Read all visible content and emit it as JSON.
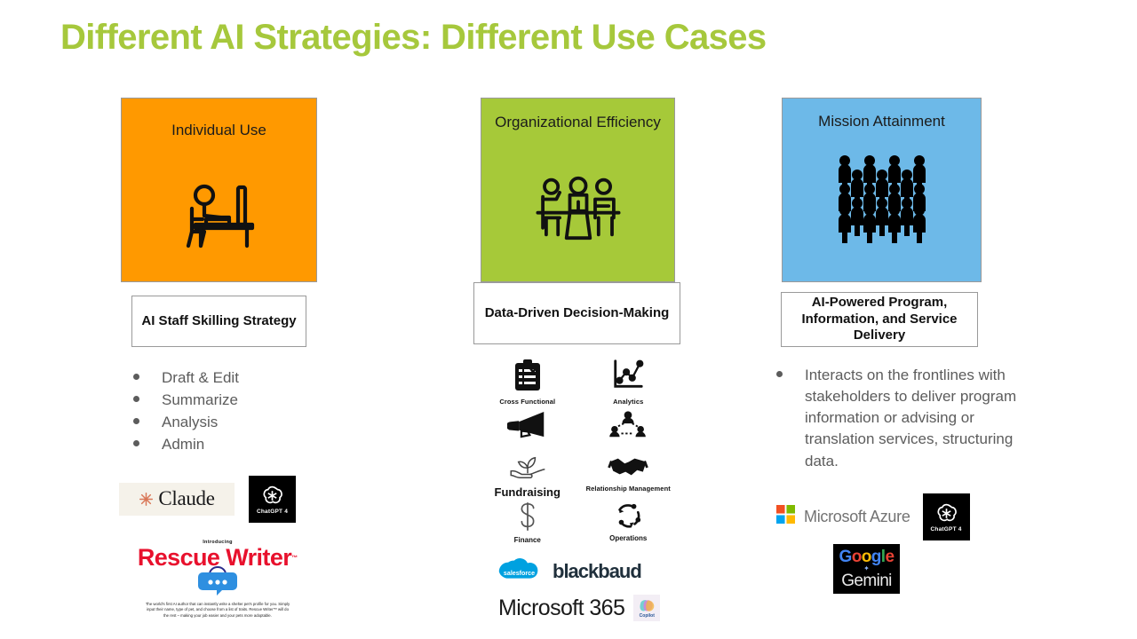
{
  "slide": {
    "title": "Different AI Strategies: Different Use Cases",
    "title_color": "#A6C83C",
    "background": "#FFFFFF"
  },
  "columns": [
    {
      "id": "individual-use",
      "header_label": "Individual Use",
      "header_color": "#FF9900",
      "header_icon": "person-at-desk-computer-icon",
      "strategy_label": "AI Staff Skilling Strategy",
      "bullets": [
        "Draft & Edit",
        "Summarize",
        "Analysis",
        "Admin"
      ],
      "logos": [
        {
          "name": "claude-logo",
          "text": "Claude",
          "background": "#F5F2EA",
          "accent": "#D97757"
        },
        {
          "name": "chatgpt4-logo",
          "text": "ChatGPT 4",
          "background": "#000000"
        }
      ],
      "promo": {
        "intro": "Introducing",
        "name": "Rescue Writer",
        "trademark": "™",
        "name_color": "#E8112D",
        "fine_print": "The world's first AI author that can instantly write a shelter pet's profile for you. Simply input their name, type of pet, and choose from a list of traits. Rescue Writer™ will do the rest – making your job easier and your pets more adoptable."
      }
    },
    {
      "id": "organizational-efficiency",
      "header_label": "Organizational Efficiency",
      "header_color": "#A6C939",
      "header_icon": "three-people-at-table-icon",
      "strategy_label": "Data-Driven Decision-Making",
      "icon_grid": [
        {
          "icon": "clipboard-checklist-icon",
          "caption": "Cross Functional",
          "size": "sm"
        },
        {
          "icon": "line-chart-icon",
          "caption": "Analytics",
          "size": "sm"
        },
        {
          "icon": "megaphone-icon",
          "caption": "",
          "size": "sm"
        },
        {
          "icon": "people-network-icon",
          "caption": "",
          "size": "sm"
        },
        {
          "icon": "hand-plant-icon",
          "caption": "Fundraising",
          "size": "lg"
        },
        {
          "icon": "handshake-icon",
          "caption": "Relationship Management",
          "size": "sm"
        },
        {
          "icon": "dollar-sign-icon",
          "caption": "Finance",
          "size": "md"
        },
        {
          "icon": "process-cycle-icon",
          "caption": "Operations",
          "size": "md"
        }
      ],
      "logos": [
        {
          "name": "salesforce-logo",
          "text": "salesforce",
          "background": "#00A1E0"
        },
        {
          "name": "blackbaud-logo",
          "text": "blackbaud",
          "mark": "®"
        },
        {
          "name": "microsoft365-logo",
          "text": "Microsoft 365"
        },
        {
          "name": "copilot-logo",
          "text": "Copilot"
        }
      ]
    },
    {
      "id": "mission-attainment",
      "header_label": "Mission Attainment",
      "header_color": "#6DB9E8",
      "header_icon": "crowd-of-people-icon",
      "strategy_label": "AI-Powered Program, Information, and Service Delivery",
      "bullets": [
        "Interacts on the frontlines with stakeholders to deliver program information or advising or translation services, structuring data."
      ],
      "logos": [
        {
          "name": "microsoft-azure-logo",
          "text": "Microsoft Azure"
        },
        {
          "name": "chatgpt4-logo",
          "text": "ChatGPT 4",
          "background": "#000000"
        },
        {
          "name": "google-gemini-logo",
          "text_1": "Google",
          "text_2": "Gemini",
          "background": "#000000"
        }
      ]
    }
  ]
}
